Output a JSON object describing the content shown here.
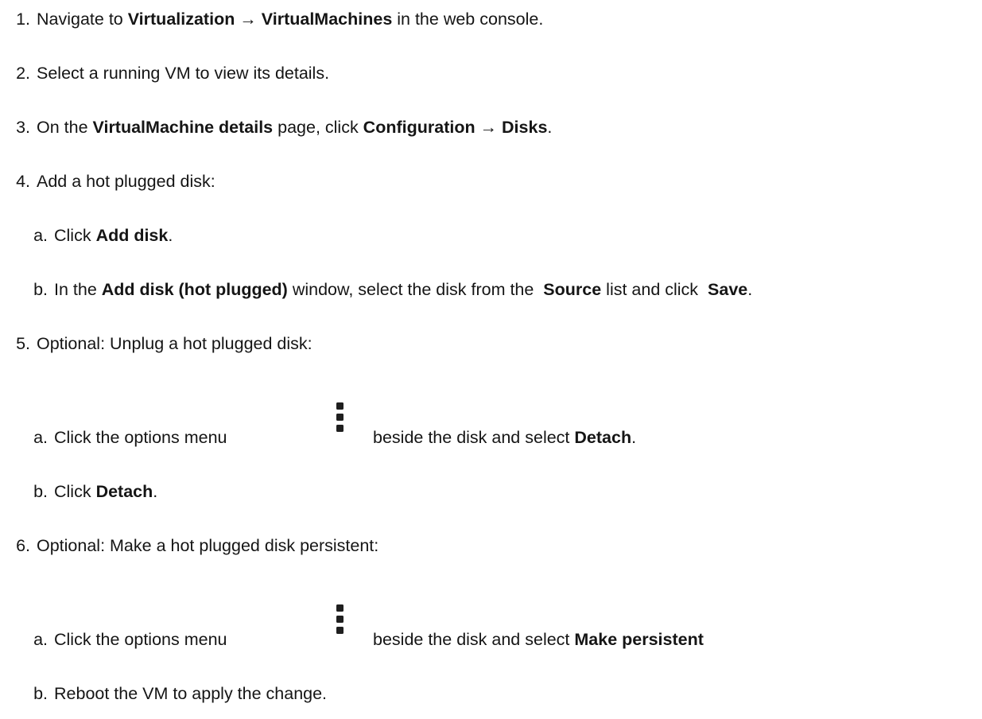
{
  "steps": [
    {
      "num": "1.",
      "segments": [
        {
          "t": "Navigate to "
        },
        {
          "t": "Virtualization → VirtualMachines",
          "b": true
        },
        {
          "t": " in the web console."
        }
      ]
    },
    {
      "num": "2.",
      "segments": [
        {
          "t": "Select a running VM to view its details."
        }
      ]
    },
    {
      "num": "3.",
      "segments": [
        {
          "t": "On the "
        },
        {
          "t": "VirtualMachine details",
          "b": true
        },
        {
          "t": " page, click "
        },
        {
          "t": "Configuration → Disks",
          "b": true
        },
        {
          "t": "."
        }
      ]
    },
    {
      "num": "4.",
      "segments": [
        {
          "t": "Add a hot plugged disk:"
        }
      ],
      "substeps": [
        {
          "num": "a.",
          "segments": [
            {
              "t": "Click "
            },
            {
              "t": "Add disk",
              "b": true
            },
            {
              "t": "."
            }
          ]
        },
        {
          "num": "b.",
          "segments": [
            {
              "t": "In the "
            },
            {
              "t": "Add disk (hot plugged)",
              "b": true
            },
            {
              "t": " window, select the disk from the  "
            },
            {
              "t": "Source",
              "b": true
            },
            {
              "t": " list and click  "
            },
            {
              "t": "Save",
              "b": true
            },
            {
              "t": "."
            }
          ]
        }
      ]
    },
    {
      "num": "5.",
      "segments": [
        {
          "t": "Optional: Unplug a hot plugged disk:"
        }
      ],
      "substeps": [
        {
          "num": "a.",
          "before": "Click the options menu",
          "icon": "kebab-icon",
          "after": [
            {
              "t": "beside the disk and select "
            },
            {
              "t": "Detach",
              "b": true
            },
            {
              "t": "."
            }
          ]
        },
        {
          "num": "b.",
          "segments": [
            {
              "t": "Click "
            },
            {
              "t": "Detach",
              "b": true
            },
            {
              "t": "."
            }
          ]
        }
      ]
    },
    {
      "num": "6.",
      "segments": [
        {
          "t": "Optional: Make a hot plugged disk persistent:"
        }
      ],
      "substeps": [
        {
          "num": "a.",
          "before": "Click the options menu",
          "icon": "kebab-icon",
          "after": [
            {
              "t": "beside the disk and select "
            },
            {
              "t": "Make persistent",
              "b": true
            }
          ]
        },
        {
          "num": "b.",
          "segments": [
            {
              "t": "Reboot the VM to apply the change."
            }
          ]
        }
      ]
    }
  ]
}
